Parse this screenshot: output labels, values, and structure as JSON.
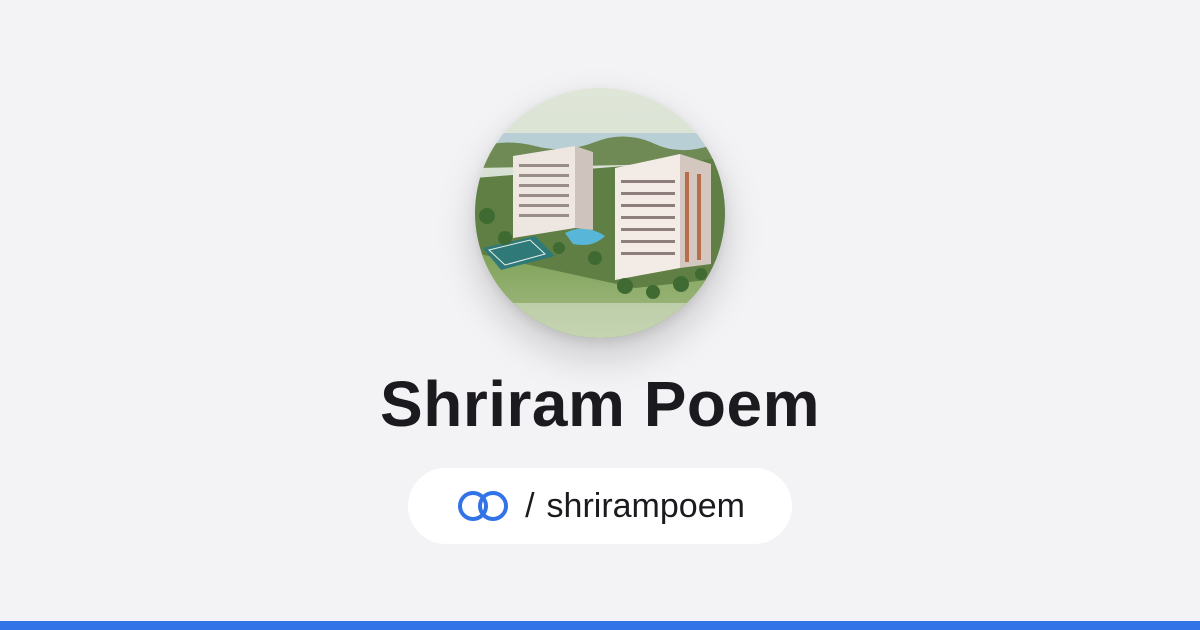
{
  "profile": {
    "name": "Shriram Poem",
    "separator": "/",
    "handle": "shrirampoem",
    "avatar_icon": "building-photo-avatar",
    "logo_icon": "linked-rings-logo-icon"
  },
  "colors": {
    "background": "#f3f3f5",
    "accent": "#3273e8",
    "text": "#1b1b1f",
    "pill": "#ffffff"
  }
}
